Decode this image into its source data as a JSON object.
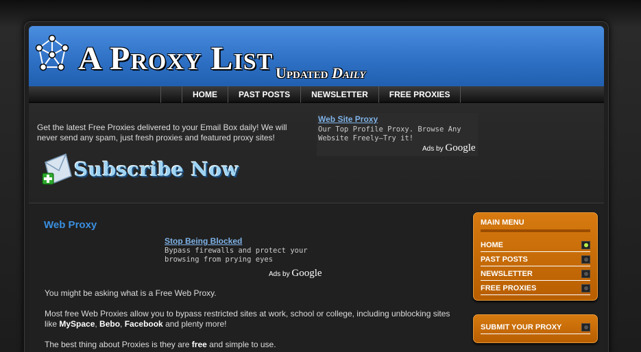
{
  "header": {
    "title": "A Proxy List",
    "tagline_a": "Updated ",
    "tagline_b": "Daily"
  },
  "nav": {
    "items": [
      "HOME",
      "PAST POSTS",
      "NEWSLETTER",
      "FREE PROXIES"
    ]
  },
  "intro": {
    "text": "Get the latest Free Proxies delivered to your Email Box daily!  We will never send any spam, just  fresh proxies and featured proxy sites!",
    "subscribe_label": "Subscribe Now"
  },
  "ad_top": {
    "title": "Web Site Proxy",
    "description": "Our Top Profile Proxy. Browse Any Website Freely—Try it!",
    "ads_by": "Ads by",
    "google": "Google"
  },
  "content": {
    "title": "Web Proxy",
    "ad": {
      "title": "Stop Being Blocked",
      "description": "Bypass firewalls and protect your browsing from prying eyes",
      "ads_by": "Ads by",
      "google": "Google"
    },
    "p1": "You might be asking what is a Free Web Proxy.",
    "p2_a": " Most free Web Proxies  allow you to bypass restricted sites at work, school or college, including unblocking sites like ",
    "p2_myspace": "MySpace",
    "p2_sep1": ", ",
    "p2_bebo": "Bebo",
    "p2_sep2": ", ",
    "p2_facebook": "Facebook",
    "p2_end": " and plenty more!",
    "p3_a": "The best thing about Proxies is they are  ",
    "p3_free": "free",
    "p3_end": " and simple to use."
  },
  "sidebar": {
    "main_menu_title": "MAIN MENU",
    "items": [
      "HOME",
      "PAST POSTS",
      "NEWSLETTER",
      "FREE PROXIES"
    ],
    "active_index": 0,
    "submit_label": "SUBMIT YOUR PROXY"
  },
  "colors": {
    "header_blue": "#2d6fc3",
    "menu_orange": "#c96c08",
    "link_blue": "#7fb3e8",
    "title_blue": "#3a8fe0"
  }
}
